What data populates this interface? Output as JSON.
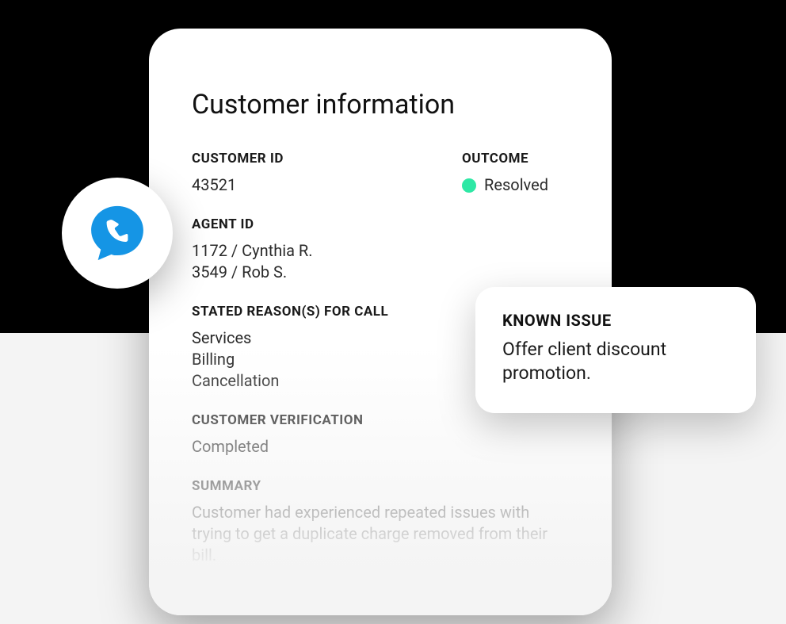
{
  "card": {
    "title": "Customer information",
    "customer_id": {
      "label": "CUSTOMER ID",
      "value": "43521"
    },
    "outcome": {
      "label": "OUTCOME",
      "value": "Resolved",
      "status_color": "#2ee8a5"
    },
    "agent_id": {
      "label": "AGENT ID",
      "line1": "1172 / Cynthia R.",
      "line2": "3549 / Rob S."
    },
    "reasons": {
      "label": "STATED REASON(S) FOR CALL",
      "line1": "Services",
      "line2": "Billing",
      "line3": "Cancellation"
    },
    "verification": {
      "label": "CUSTOMER VERIFICATION",
      "value": "Completed"
    },
    "summary": {
      "label": "SUMMARY",
      "value": "Customer had experienced repeated issues with trying to get a duplicate charge removed from their bill."
    }
  },
  "known_issue": {
    "label": "KNOWN ISSUE",
    "text": "Offer client discount promotion."
  },
  "phone_icon": {
    "color": "#1595e5"
  }
}
